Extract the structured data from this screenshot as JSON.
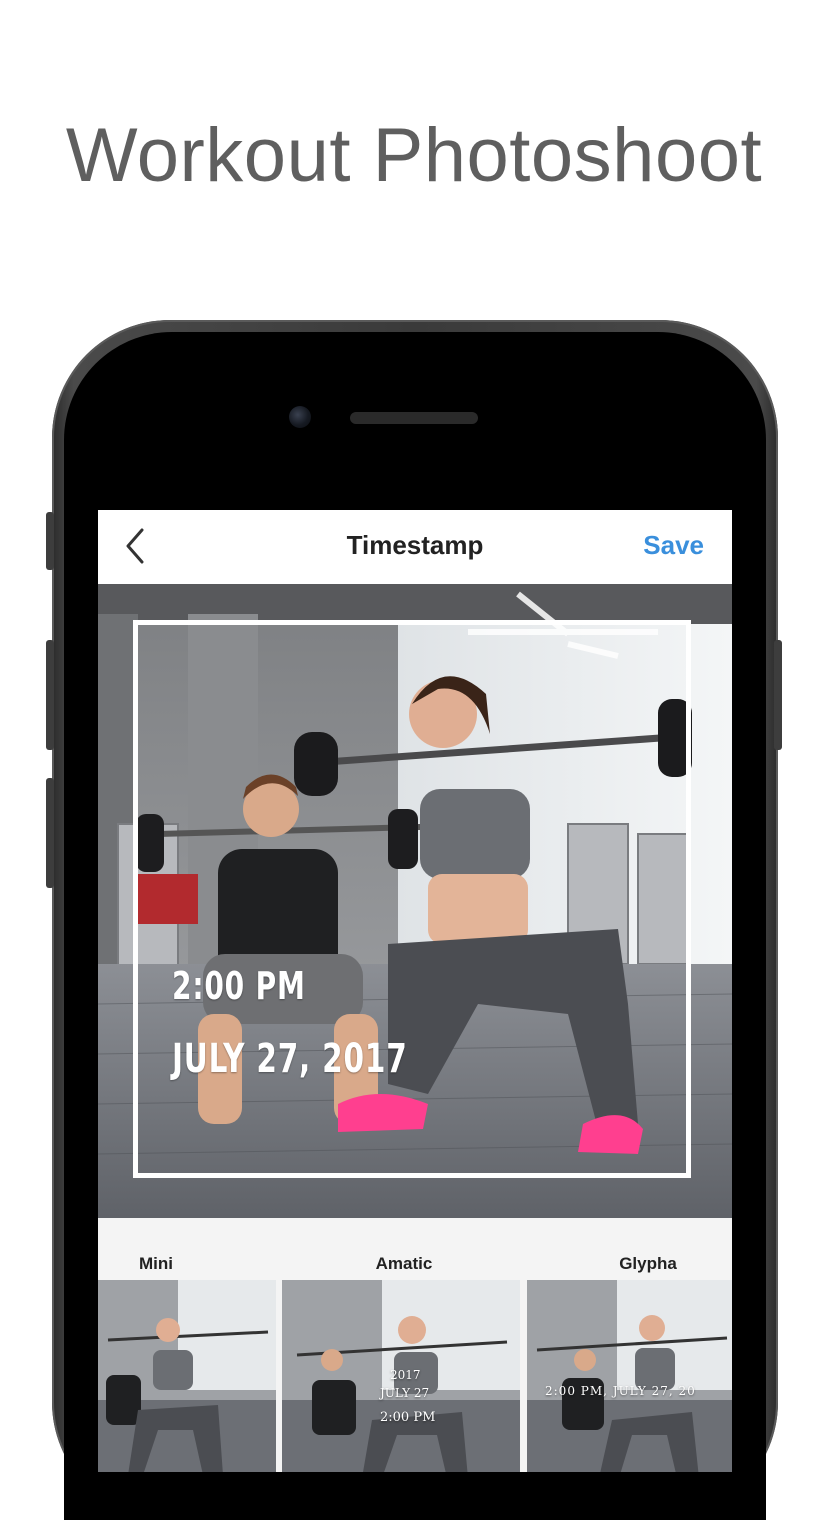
{
  "headline": "Workout Photoshoot",
  "navbar": {
    "title": "Timestamp",
    "save_label": "Save"
  },
  "stamp": {
    "time": "2:00 PM",
    "date": "JULY 27, 2017"
  },
  "styles": [
    {
      "label": "Mini",
      "stamp_lines": []
    },
    {
      "label": "Amatic",
      "stamp_lines": [
        "2017",
        "JULY 27",
        "2:00 PM"
      ]
    },
    {
      "label": "Glypha",
      "stamp_lines": [
        "2:00 PM, JULY 27, 20"
      ]
    }
  ],
  "colors": {
    "accent": "#3a8fdc",
    "headline": "#5f5f5f",
    "phone_body": "#3a3a3a"
  }
}
